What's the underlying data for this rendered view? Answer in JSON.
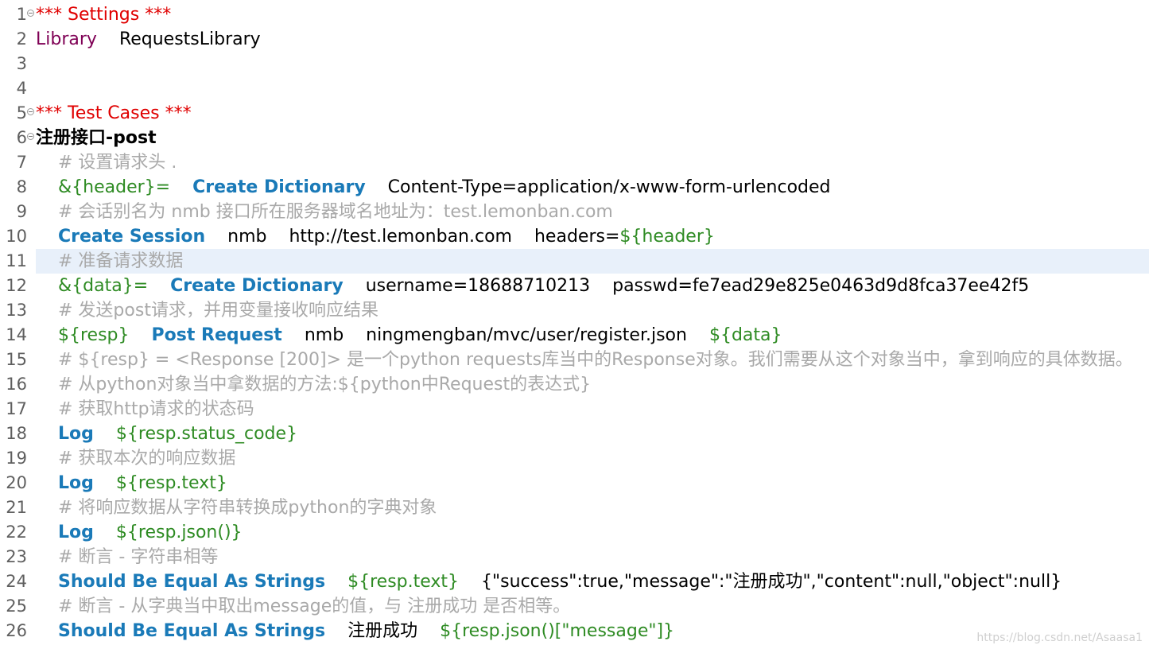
{
  "lines": [
    {
      "num": "1",
      "fold": true,
      "indent": false,
      "tokens": [
        {
          "t": "*** Settings ***",
          "k": "section"
        }
      ]
    },
    {
      "num": "2",
      "fold": false,
      "indent": false,
      "tokens": [
        {
          "t": "Library",
          "k": "setting"
        },
        {
          "t": "RequestsLibrary",
          "k": "plain"
        }
      ]
    },
    {
      "num": "3",
      "fold": false,
      "indent": false,
      "tokens": []
    },
    {
      "num": "4",
      "fold": false,
      "indent": false,
      "tokens": []
    },
    {
      "num": "5",
      "fold": true,
      "indent": false,
      "tokens": [
        {
          "t": "*** Test Cases ***",
          "k": "section"
        }
      ]
    },
    {
      "num": "6",
      "fold": true,
      "indent": false,
      "tokens": [
        {
          "t": "注册接口-post",
          "k": "testcase"
        }
      ]
    },
    {
      "num": "7",
      "fold": false,
      "indent": true,
      "tokens": [
        {
          "t": "# 设置请求头 .",
          "k": "comment"
        }
      ]
    },
    {
      "num": "8",
      "fold": false,
      "indent": true,
      "tokens": [
        {
          "t": "&{header}=",
          "k": "var"
        },
        {
          "t": "Create Dictionary",
          "k": "keyword"
        },
        {
          "t": "Content-Type=application/x-www-form-urlencoded",
          "k": "plain"
        }
      ]
    },
    {
      "num": "9",
      "fold": false,
      "indent": true,
      "tokens": [
        {
          "t": "# 会话别名为 nmb    接口所在服务器域名地址为：test.lemonban.com",
          "k": "comment"
        }
      ]
    },
    {
      "num": "10",
      "fold": false,
      "indent": true,
      "tokens": [
        {
          "t": "Create Session",
          "k": "keyword"
        },
        {
          "t": "nmb",
          "k": "plain"
        },
        {
          "t": "http://test.lemonban.com",
          "k": "plain"
        },
        {
          "t": "headers=",
          "k": "plain",
          "join": true
        },
        {
          "t": "${header}",
          "k": "var"
        }
      ]
    },
    {
      "num": "11",
      "fold": false,
      "indent": true,
      "highlight": true,
      "tokens": [
        {
          "t": "# 准备请求数据",
          "k": "comment"
        }
      ]
    },
    {
      "num": "12",
      "fold": false,
      "indent": true,
      "tokens": [
        {
          "t": "&{data}=",
          "k": "var"
        },
        {
          "t": "Create Dictionary",
          "k": "keyword"
        },
        {
          "t": "username=18688710213",
          "k": "plain"
        },
        {
          "t": "passwd=fe7ead29e825e0463d9d8fca37ee42f5",
          "k": "plain"
        }
      ]
    },
    {
      "num": "13",
      "fold": false,
      "indent": true,
      "tokens": [
        {
          "t": "# 发送post请求，并用变量接收响应结果",
          "k": "comment"
        }
      ]
    },
    {
      "num": "14",
      "fold": false,
      "indent": true,
      "tokens": [
        {
          "t": "${resp}",
          "k": "var"
        },
        {
          "t": "Post Request",
          "k": "keyword"
        },
        {
          "t": "nmb",
          "k": "plain"
        },
        {
          "t": "ningmengban/mvc/user/register.json",
          "k": "plain"
        },
        {
          "t": "${data}",
          "k": "var"
        }
      ]
    },
    {
      "num": "15",
      "fold": false,
      "indent": true,
      "tokens": [
        {
          "t": "# ${resp} = <Response [200]>   是一个python requests库当中的Response对象。我们需要从这个对象当中，拿到响应的具体数据。",
          "k": "comment"
        }
      ]
    },
    {
      "num": "16",
      "fold": false,
      "indent": true,
      "tokens": [
        {
          "t": "# 从python对象当中拿数据的方法:${python中Request的表达式}",
          "k": "comment"
        }
      ]
    },
    {
      "num": "17",
      "fold": false,
      "indent": true,
      "tokens": [
        {
          "t": "# 获取http请求的状态码",
          "k": "comment"
        }
      ]
    },
    {
      "num": "18",
      "fold": false,
      "indent": true,
      "tokens": [
        {
          "t": "Log",
          "k": "keyword"
        },
        {
          "t": "${resp.status_code}",
          "k": "var"
        }
      ]
    },
    {
      "num": "19",
      "fold": false,
      "indent": true,
      "tokens": [
        {
          "t": "# 获取本次的响应数据",
          "k": "comment"
        }
      ]
    },
    {
      "num": "20",
      "fold": false,
      "indent": true,
      "tokens": [
        {
          "t": "Log",
          "k": "keyword"
        },
        {
          "t": "${resp.text}",
          "k": "var"
        }
      ]
    },
    {
      "num": "21",
      "fold": false,
      "indent": true,
      "tokens": [
        {
          "t": "# 将响应数据从字符串转换成python的字典对象",
          "k": "comment"
        }
      ]
    },
    {
      "num": "22",
      "fold": false,
      "indent": true,
      "tokens": [
        {
          "t": "Log",
          "k": "keyword"
        },
        {
          "t": "${resp.json()}",
          "k": "var"
        }
      ]
    },
    {
      "num": "23",
      "fold": false,
      "indent": true,
      "tokens": [
        {
          "t": "# 断言 - 字符串相等",
          "k": "comment"
        }
      ]
    },
    {
      "num": "24",
      "fold": false,
      "indent": true,
      "tokens": [
        {
          "t": "Should Be Equal As Strings",
          "k": "keyword"
        },
        {
          "t": "${resp.text}",
          "k": "var"
        },
        {
          "t": "{\"success\":true,\"message\":\"注册成功\",\"content\":null,\"object\":null}",
          "k": "plain"
        }
      ]
    },
    {
      "num": "25",
      "fold": false,
      "indent": true,
      "tokens": [
        {
          "t": "# 断言 - 从字典当中取出message的值，与 注册成功  是否相等。",
          "k": "comment"
        }
      ]
    },
    {
      "num": "26",
      "fold": false,
      "indent": true,
      "tokens": [
        {
          "t": "Should Be Equal As Strings",
          "k": "keyword"
        },
        {
          "t": "注册成功",
          "k": "plain"
        },
        {
          "t": "${resp.json()[\"message\"]}",
          "k": "var"
        }
      ]
    }
  ],
  "watermark": "https://blog.csdn.net/Asaasa1",
  "colors": {
    "section": "#e00000",
    "setting": "#7f0055",
    "keyword": "#1a7ab8",
    "variable": "#2e8b23",
    "comment": "#a9a9a9",
    "plain": "#000000",
    "line_highlight": "#e8f0fa"
  }
}
